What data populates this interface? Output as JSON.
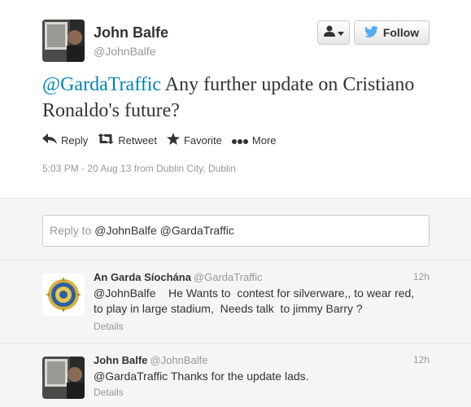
{
  "tweet": {
    "author_name": "John Balfe",
    "author_handle": "@JohnBalfe",
    "text_mention": "@GardaTraffic",
    "text_body": " Any further update on Cristiano Ronaldo's future?",
    "timestamp": "5:03 PM - 20 Aug 13 from Dublin City, Dublin"
  },
  "header": {
    "follow_label": "Follow"
  },
  "actions": {
    "reply": "Reply",
    "retweet": "Retweet",
    "favorite": "Favorite",
    "more": "More"
  },
  "reply_box": {
    "prefix": "Reply to ",
    "mentions": "@JohnBalfe @GardaTraffic"
  },
  "replies": [
    {
      "name": "An Garda Síochána",
      "handle": "@GardaTraffic",
      "time": "12h",
      "text": "@JohnBalfe    He Wants to  contest for silverware,, to wear red,\nto play in large stadium,  Needs talk  to jimmy Barry ?",
      "details": "Details"
    },
    {
      "name": "John Balfe",
      "handle": "@JohnBalfe",
      "time": "12h",
      "text": "@GardaTraffic Thanks for the update lads.",
      "details": "Details"
    }
  ],
  "colors": {
    "link": "#0084b4",
    "twitter_blue": "#55acee",
    "muted": "#999999",
    "background_alt": "#f5f5f5"
  },
  "icons": [
    "user-icon",
    "caret-down-icon",
    "twitter-bird-icon",
    "reply-icon",
    "retweet-icon",
    "star-icon",
    "more-dots-icon"
  ]
}
